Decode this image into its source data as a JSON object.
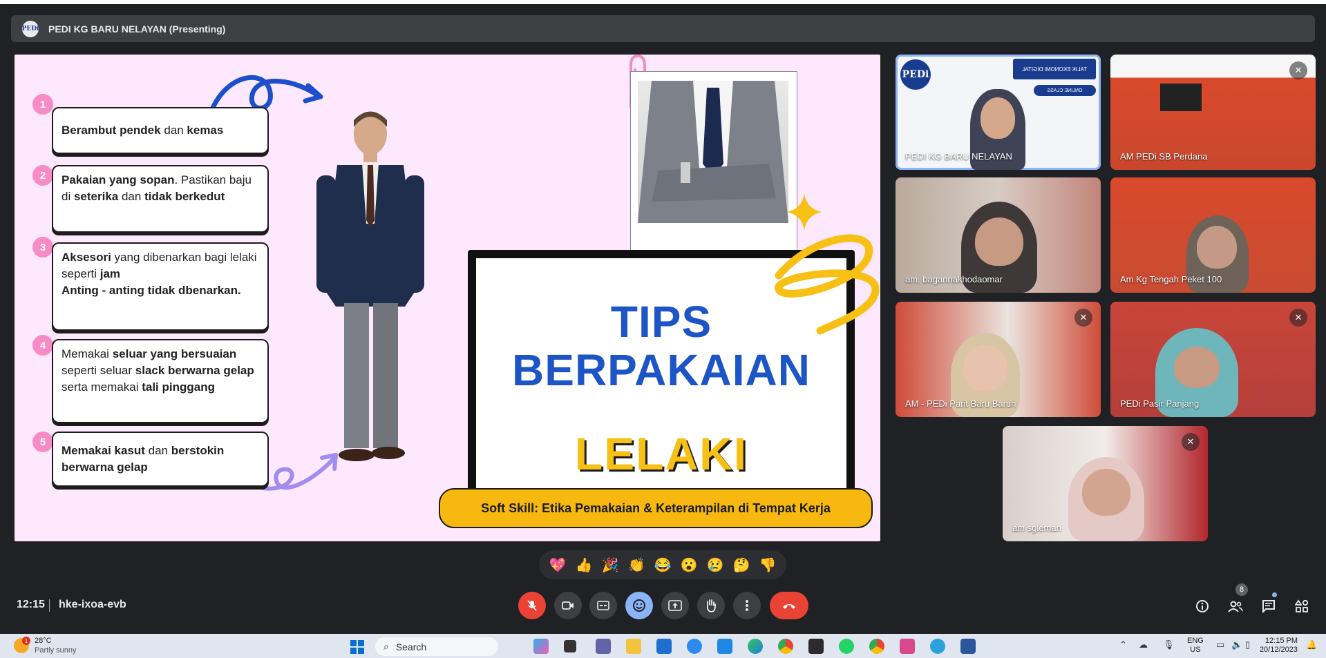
{
  "presenter": {
    "name": "PEDI KG BARU NELAYAN (Presenting)",
    "logo": "PEDi"
  },
  "slide": {
    "tips": [
      {
        "num": "1",
        "html": "<b>Berambut pendek</b> dan <b>kemas</b>"
      },
      {
        "num": "2",
        "html": "<b>Pakaian yang sopan</b>. Pastikan baju di <b>seterika</b> dan <b>tidak berkedut</b>"
      },
      {
        "num": "3",
        "html": "<b>Aksesori</b> yang dibenarkan bagi lelaki seperti <b>jam</b><br><b>Anting - anting tidak dbenarkan.</b>"
      },
      {
        "num": "4",
        "html": "Memakai <b>seluar yang bersuaian</b> seperti seluar <b>slack berwarna gelap</b> serta memakai <b>tali pinggang</b>"
      },
      {
        "num": "5",
        "html": "<b>Memakai kasut</b>  dan <b>berstokin berwarna gelap</b>"
      }
    ],
    "title_line1": "TIPS",
    "title_line2": "BERPAKAIAN",
    "title_line3": "LELAKI",
    "banner": "Soft Skill: Etika Pemakaian & Keterampilan di Tempat Kerja"
  },
  "participants": [
    {
      "name": "PEDI KG BARU NELAYAN",
      "muted": false,
      "active": true
    },
    {
      "name": "AM PEDi SB Perdana",
      "muted": true,
      "active": false
    },
    {
      "name": "am. bagannakhodaomar",
      "muted": false,
      "active": false
    },
    {
      "name": "Am Kg Tengah Peket 100",
      "muted": false,
      "active": false
    },
    {
      "name": "AM - PEDi Parit Baru Baruh",
      "muted": true,
      "active": false
    },
    {
      "name": "PEDi Pasir Panjang",
      "muted": true,
      "active": false
    },
    {
      "name": "am sgleman",
      "muted": true,
      "active": false
    }
  ],
  "presenter_tile_text": {
    "banner": "TALIK EKONOMI DIGITAL",
    "sub": "ONLINE CLASS"
  },
  "reactions": [
    "💖",
    "👍",
    "🎉",
    "👏",
    "😂",
    "😮",
    "😢",
    "🤔",
    "👎"
  ],
  "meeting": {
    "time": "12:15",
    "code": "hke-ixoa-evb",
    "people_count": "8"
  },
  "taskbar": {
    "temp": "28°C",
    "condition": "Partly sunny",
    "weather_badge": "1",
    "search_label": "Search",
    "lang_line1": "ENG",
    "lang_line2": "US",
    "clock_time": "12:15 PM",
    "clock_date": "20/12/2023"
  },
  "colors": {
    "accent": "#8ab4f8",
    "danger": "#ea4335",
    "slide_bg": "#fde8fd",
    "title_blue": "#1d55c7",
    "title_yellow": "#f7c015"
  }
}
